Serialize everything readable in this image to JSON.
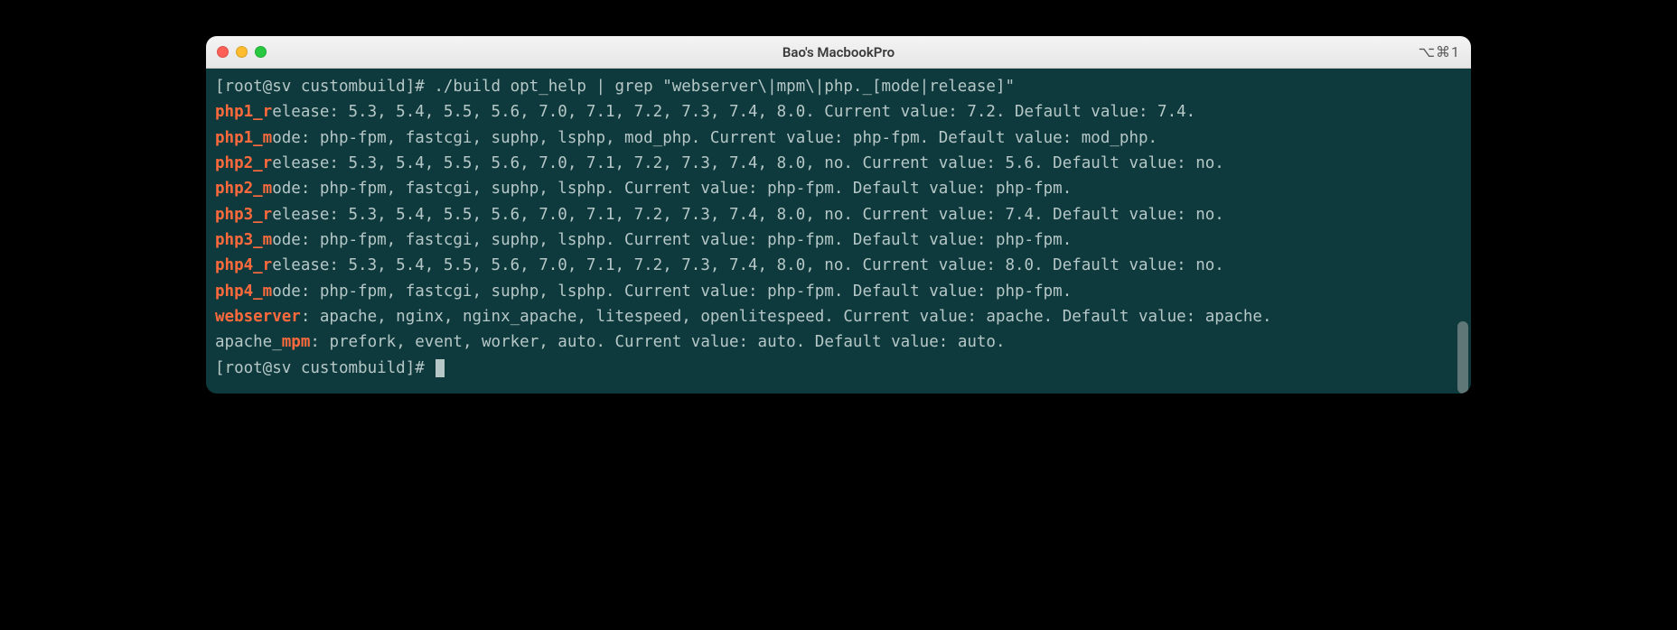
{
  "window": {
    "title": "Bao's MacbookPro",
    "shortcut": "⌥⌘1"
  },
  "prompt": {
    "text": "[root@sv custombuild]# ",
    "command": "./build opt_help | grep \"webserver\\|mpm\\|php._[mode|release]\""
  },
  "lines": [
    {
      "hl": "php1_r",
      "rest": "elease: 5.3, 5.4, 5.5, 5.6, 7.0, 7.1, 7.2, 7.3, 7.4, 8.0. Current value: 7.2. Default value: 7.4."
    },
    {
      "hl": "php1_m",
      "rest": "ode: php-fpm, fastcgi, suphp, lsphp, mod_php. Current value: php-fpm. Default value: mod_php."
    },
    {
      "hl": "php2_r",
      "rest": "elease: 5.3, 5.4, 5.5, 5.6, 7.0, 7.1, 7.2, 7.3, 7.4, 8.0, no. Current value: 5.6. Default value: no."
    },
    {
      "hl": "php2_m",
      "rest": "ode: php-fpm, fastcgi, suphp, lsphp. Current value: php-fpm. Default value: php-fpm."
    },
    {
      "hl": "php3_r",
      "rest": "elease: 5.3, 5.4, 5.5, 5.6, 7.0, 7.1, 7.2, 7.3, 7.4, 8.0, no. Current value: 7.4. Default value: no."
    },
    {
      "hl": "php3_m",
      "rest": "ode: php-fpm, fastcgi, suphp, lsphp. Current value: php-fpm. Default value: php-fpm."
    },
    {
      "hl": "php4_r",
      "rest": "elease: 5.3, 5.4, 5.5, 5.6, 7.0, 7.1, 7.2, 7.3, 7.4, 8.0, no. Current value: 8.0. Default value: no."
    },
    {
      "hl": "php4_m",
      "rest": "ode: php-fpm, fastcgi, suphp, lsphp. Current value: php-fpm. Default value: php-fpm."
    },
    {
      "hl": "webserver",
      "rest": ": apache, nginx, nginx_apache, litespeed, openlitespeed. Current value: apache. Default value: apache."
    },
    {
      "pre": "apache_",
      "hl": "mpm",
      "rest": ": prefork, event, worker, auto. Current value: auto. Default value: auto."
    }
  ],
  "prompt2": "[root@sv custombuild]# "
}
